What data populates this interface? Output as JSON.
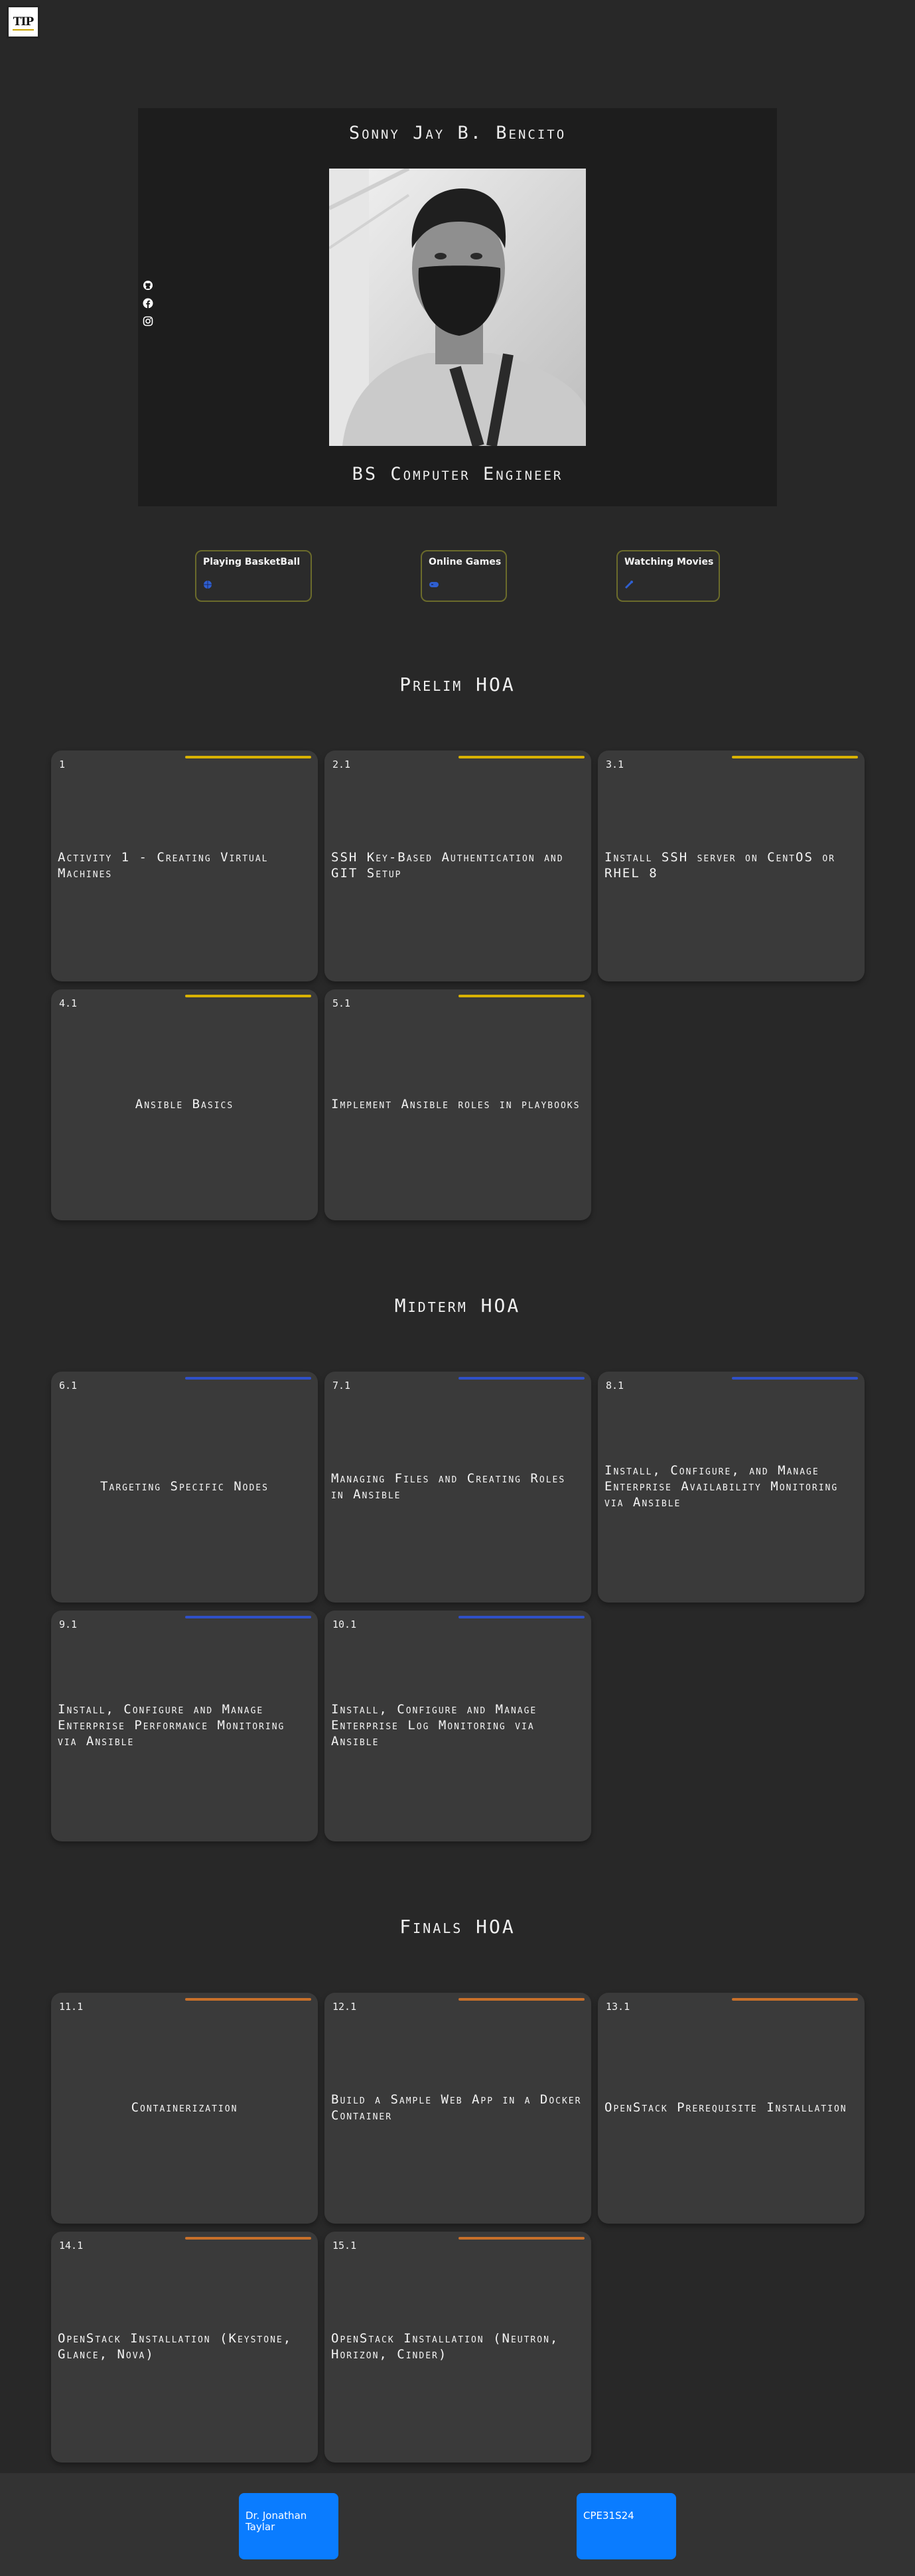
{
  "logo": {
    "text": "TIP"
  },
  "profile": {
    "name": "Sonny Jay B. Bencito",
    "role": "BS Computer Engineer",
    "social": [
      {
        "icon": "github-icon"
      },
      {
        "icon": "facebook-icon"
      },
      {
        "icon": "instagram-icon"
      }
    ]
  },
  "hobbies": [
    {
      "label": "Playing BasketBall",
      "icon": "basketball-icon"
    },
    {
      "label": "Online Games",
      "icon": "gamepad-icon"
    },
    {
      "label": "Watching Movies",
      "icon": "movie-icon"
    }
  ],
  "sections": [
    {
      "title": "Prelim HOA",
      "accent": "#d9b200",
      "cards": [
        {
          "num": "1",
          "title": "Activity 1 - Creating Virtual Machines"
        },
        {
          "num": "2.1",
          "title": "SSH Key-Based Authentication and GIT Setup"
        },
        {
          "num": "3.1",
          "title": "Install SSH server on CentOS or RHEL 8"
        },
        {
          "num": "4.1",
          "title": "Ansible Basics"
        },
        {
          "num": "5.1",
          "title": "Implement Ansible roles in playbooks"
        }
      ]
    },
    {
      "title": "Midterm HOA",
      "accent": "#2f50c8",
      "cards": [
        {
          "num": "6.1",
          "title": "Targeting Specific Nodes"
        },
        {
          "num": "7.1",
          "title": "Managing Files and Creating Roles in Ansible"
        },
        {
          "num": "8.1",
          "title": "Install, Configure, and Manage Enterprise Availability Monitoring via Ansible"
        },
        {
          "num": "9.1",
          "title": "Install, Configure and Manage Enterprise Performance Monitoring via Ansible"
        },
        {
          "num": "10.1",
          "title": "Install, Configure and Manage Enterprise Log Monitoring via Ansible"
        }
      ]
    },
    {
      "title": "Finals HOA",
      "accent": "#c8702a",
      "cards": [
        {
          "num": "11.1",
          "title": "Containerization"
        },
        {
          "num": "12.1",
          "title": "Build a Sample Web App in a Docker Container"
        },
        {
          "num": "13.1",
          "title": "OpenStack Prerequisite Installation"
        },
        {
          "num": "14.1",
          "title": "OpenStack Installation (Keystone, Glance, Nova)"
        },
        {
          "num": "15.1",
          "title": "OpenStack Installation (Neutron, Horizon, Cinder)"
        }
      ]
    }
  ],
  "footer": {
    "instructor": "Dr. Jonathan Taylar",
    "course": "CPE31S24"
  }
}
